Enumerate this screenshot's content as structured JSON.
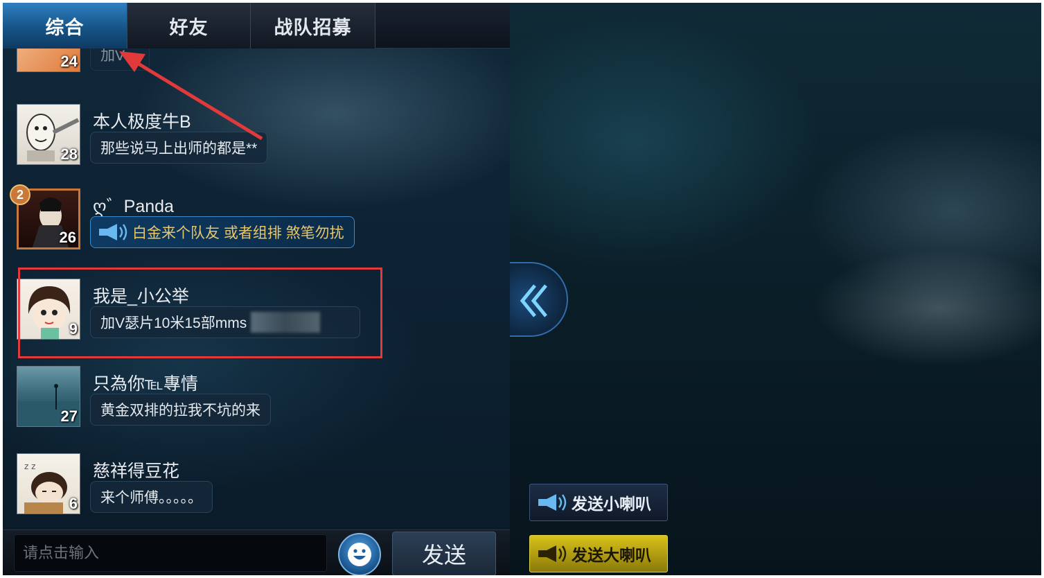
{
  "tabs": [
    {
      "label": "综合",
      "active": true
    },
    {
      "label": "好友",
      "active": false
    },
    {
      "label": "战队招募",
      "active": false
    }
  ],
  "messages": [
    {
      "username": "",
      "text": "加V…",
      "level": "24"
    },
    {
      "username": "本人极度牛B",
      "text": "那些说马上出师的都是**",
      "level": "28"
    },
    {
      "username": "ღ゛Panda",
      "text": "白金来个队友 或者组排 煞笔勿扰",
      "level": "26",
      "badge": "2",
      "horn": true
    },
    {
      "username": "我是_小公举",
      "text": "加V瑟片10米15部mms",
      "level": "9"
    },
    {
      "username": "只為你℡專情",
      "text": "黄金双排的拉我不坑的来",
      "level": "27"
    },
    {
      "username": "慈祥得豆花",
      "text": "来个师傅。。。。。",
      "level": "6"
    }
  ],
  "input": {
    "placeholder": "请点击输入"
  },
  "send_label": "发送",
  "small_horn_label": "发送小喇叭",
  "big_horn_label": "发送大喇叭",
  "icons": {
    "emoji": "smiley-icon",
    "collapse": "double-chevron-left-icon",
    "horn": "megaphone-icon"
  },
  "colors": {
    "active_tab": "#1d6aa8",
    "highlight": "#e23a3a",
    "big_horn": "#d8c21a"
  }
}
